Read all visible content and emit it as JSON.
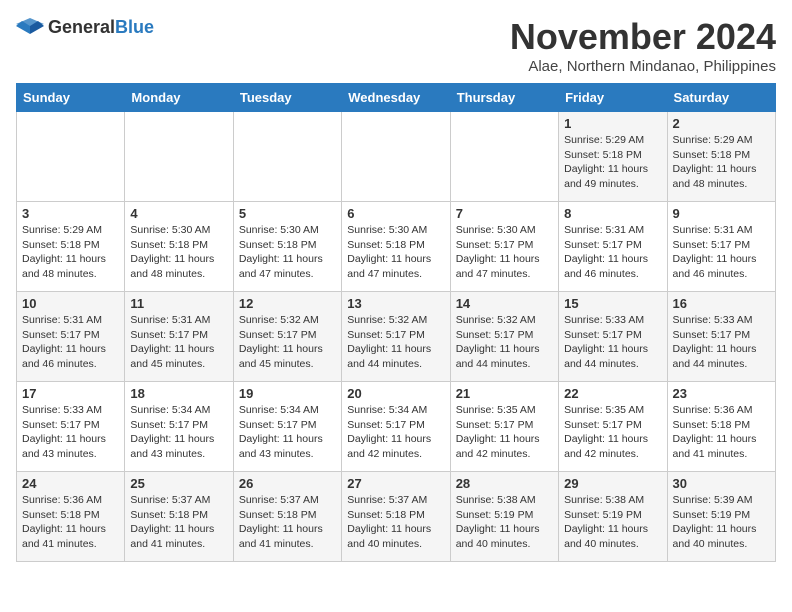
{
  "header": {
    "logo_general": "General",
    "logo_blue": "Blue",
    "month_title": "November 2024",
    "location": "Alae, Northern Mindanao, Philippines"
  },
  "weekdays": [
    "Sunday",
    "Monday",
    "Tuesday",
    "Wednesday",
    "Thursday",
    "Friday",
    "Saturday"
  ],
  "weeks": [
    [
      {
        "day": "",
        "info": ""
      },
      {
        "day": "",
        "info": ""
      },
      {
        "day": "",
        "info": ""
      },
      {
        "day": "",
        "info": ""
      },
      {
        "day": "",
        "info": ""
      },
      {
        "day": "1",
        "info": "Sunrise: 5:29 AM\nSunset: 5:18 PM\nDaylight: 11 hours\nand 49 minutes."
      },
      {
        "day": "2",
        "info": "Sunrise: 5:29 AM\nSunset: 5:18 PM\nDaylight: 11 hours\nand 48 minutes."
      }
    ],
    [
      {
        "day": "3",
        "info": "Sunrise: 5:29 AM\nSunset: 5:18 PM\nDaylight: 11 hours\nand 48 minutes."
      },
      {
        "day": "4",
        "info": "Sunrise: 5:30 AM\nSunset: 5:18 PM\nDaylight: 11 hours\nand 48 minutes."
      },
      {
        "day": "5",
        "info": "Sunrise: 5:30 AM\nSunset: 5:18 PM\nDaylight: 11 hours\nand 47 minutes."
      },
      {
        "day": "6",
        "info": "Sunrise: 5:30 AM\nSunset: 5:18 PM\nDaylight: 11 hours\nand 47 minutes."
      },
      {
        "day": "7",
        "info": "Sunrise: 5:30 AM\nSunset: 5:17 PM\nDaylight: 11 hours\nand 47 minutes."
      },
      {
        "day": "8",
        "info": "Sunrise: 5:31 AM\nSunset: 5:17 PM\nDaylight: 11 hours\nand 46 minutes."
      },
      {
        "day": "9",
        "info": "Sunrise: 5:31 AM\nSunset: 5:17 PM\nDaylight: 11 hours\nand 46 minutes."
      }
    ],
    [
      {
        "day": "10",
        "info": "Sunrise: 5:31 AM\nSunset: 5:17 PM\nDaylight: 11 hours\nand 46 minutes."
      },
      {
        "day": "11",
        "info": "Sunrise: 5:31 AM\nSunset: 5:17 PM\nDaylight: 11 hours\nand 45 minutes."
      },
      {
        "day": "12",
        "info": "Sunrise: 5:32 AM\nSunset: 5:17 PM\nDaylight: 11 hours\nand 45 minutes."
      },
      {
        "day": "13",
        "info": "Sunrise: 5:32 AM\nSunset: 5:17 PM\nDaylight: 11 hours\nand 44 minutes."
      },
      {
        "day": "14",
        "info": "Sunrise: 5:32 AM\nSunset: 5:17 PM\nDaylight: 11 hours\nand 44 minutes."
      },
      {
        "day": "15",
        "info": "Sunrise: 5:33 AM\nSunset: 5:17 PM\nDaylight: 11 hours\nand 44 minutes."
      },
      {
        "day": "16",
        "info": "Sunrise: 5:33 AM\nSunset: 5:17 PM\nDaylight: 11 hours\nand 44 minutes."
      }
    ],
    [
      {
        "day": "17",
        "info": "Sunrise: 5:33 AM\nSunset: 5:17 PM\nDaylight: 11 hours\nand 43 minutes."
      },
      {
        "day": "18",
        "info": "Sunrise: 5:34 AM\nSunset: 5:17 PM\nDaylight: 11 hours\nand 43 minutes."
      },
      {
        "day": "19",
        "info": "Sunrise: 5:34 AM\nSunset: 5:17 PM\nDaylight: 11 hours\nand 43 minutes."
      },
      {
        "day": "20",
        "info": "Sunrise: 5:34 AM\nSunset: 5:17 PM\nDaylight: 11 hours\nand 42 minutes."
      },
      {
        "day": "21",
        "info": "Sunrise: 5:35 AM\nSunset: 5:17 PM\nDaylight: 11 hours\nand 42 minutes."
      },
      {
        "day": "22",
        "info": "Sunrise: 5:35 AM\nSunset: 5:17 PM\nDaylight: 11 hours\nand 42 minutes."
      },
      {
        "day": "23",
        "info": "Sunrise: 5:36 AM\nSunset: 5:18 PM\nDaylight: 11 hours\nand 41 minutes."
      }
    ],
    [
      {
        "day": "24",
        "info": "Sunrise: 5:36 AM\nSunset: 5:18 PM\nDaylight: 11 hours\nand 41 minutes."
      },
      {
        "day": "25",
        "info": "Sunrise: 5:37 AM\nSunset: 5:18 PM\nDaylight: 11 hours\nand 41 minutes."
      },
      {
        "day": "26",
        "info": "Sunrise: 5:37 AM\nSunset: 5:18 PM\nDaylight: 11 hours\nand 41 minutes."
      },
      {
        "day": "27",
        "info": "Sunrise: 5:37 AM\nSunset: 5:18 PM\nDaylight: 11 hours\nand 40 minutes."
      },
      {
        "day": "28",
        "info": "Sunrise: 5:38 AM\nSunset: 5:19 PM\nDaylight: 11 hours\nand 40 minutes."
      },
      {
        "day": "29",
        "info": "Sunrise: 5:38 AM\nSunset: 5:19 PM\nDaylight: 11 hours\nand 40 minutes."
      },
      {
        "day": "30",
        "info": "Sunrise: 5:39 AM\nSunset: 5:19 PM\nDaylight: 11 hours\nand 40 minutes."
      }
    ]
  ]
}
